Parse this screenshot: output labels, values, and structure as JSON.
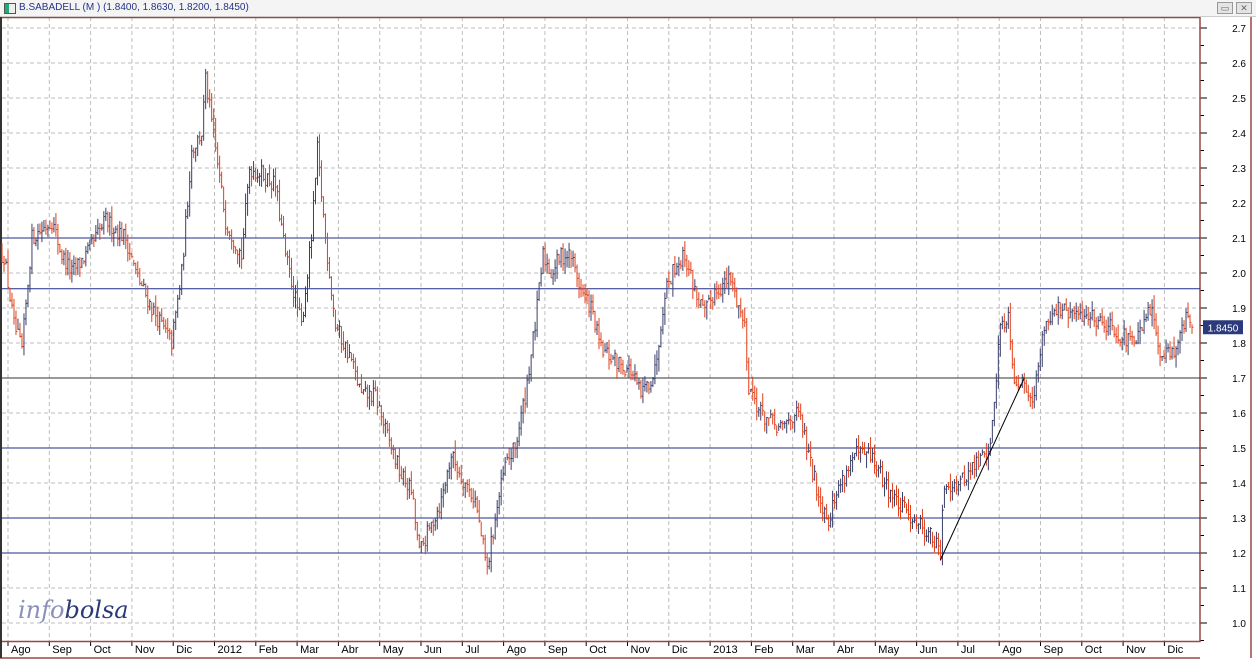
{
  "window": {
    "title": "B.SABADELL (M ) (1.8400, 1.8630, 1.8200, 1.8450)",
    "minimize": "▭",
    "close": "✕"
  },
  "logo": {
    "part1": "info",
    "part2": "bolsa"
  },
  "chart_data": {
    "type": "ohlc",
    "title": "B.SABADELL (M )",
    "last_ohlc": {
      "open": 1.84,
      "high": 1.863,
      "low": 1.82,
      "close": 1.845
    },
    "last_price_label": "1.8450",
    "ylim": [
      0.95,
      2.75
    ],
    "yticks": [
      "2.7",
      "2.6",
      "2.5",
      "2.4",
      "2.3",
      "2.2",
      "2.1",
      "2.0",
      "1.9",
      "1.8",
      "1.7",
      "1.6",
      "1.5",
      "1.4",
      "1.3",
      "1.2",
      "1.1",
      "1.0"
    ],
    "xticks": [
      "Ago",
      "Sep",
      "Oct",
      "Nov",
      "Dic",
      "2012",
      "Feb",
      "Mar",
      "Abr",
      "May",
      "Jun",
      "Jul",
      "Ago",
      "Sep",
      "Oct",
      "Nov",
      "Dic",
      "2013",
      "Feb",
      "Mar",
      "Abr",
      "May",
      "Jun",
      "Jul",
      "Ago",
      "Sep",
      "Oct",
      "Nov",
      "Dic"
    ],
    "x_unit": "trading-day index (approx.)",
    "n_days": 600,
    "horizontal_levels": [
      2.1,
      1.955,
      1.7,
      1.5,
      1.3,
      1.2
    ],
    "trendline": [
      [
        470,
        1.18
      ],
      [
        512,
        1.7
      ]
    ],
    "close_keypoints": [
      [
        1,
        2.05
      ],
      [
        6,
        1.85
      ],
      [
        10,
        1.78
      ],
      [
        15,
        2.1
      ],
      [
        25,
        2.15
      ],
      [
        30,
        2.05
      ],
      [
        35,
        2.0
      ],
      [
        42,
        2.05
      ],
      [
        52,
        2.15
      ],
      [
        62,
        2.1
      ],
      [
        67,
        2.0
      ],
      [
        75,
        1.9
      ],
      [
        85,
        1.8
      ],
      [
        90,
        2.0
      ],
      [
        95,
        2.35
      ],
      [
        100,
        2.4
      ],
      [
        102,
        2.55
      ],
      [
        107,
        2.35
      ],
      [
        112,
        2.15
      ],
      [
        120,
        2.05
      ],
      [
        124,
        2.3
      ],
      [
        131,
        2.28
      ],
      [
        137,
        2.25
      ],
      [
        142,
        2.05
      ],
      [
        150,
        1.85
      ],
      [
        155,
        2.1
      ],
      [
        158,
        2.35
      ],
      [
        162,
        2.1
      ],
      [
        167,
        1.85
      ],
      [
        175,
        1.75
      ],
      [
        180,
        1.65
      ],
      [
        187,
        1.65
      ],
      [
        192,
        1.55
      ],
      [
        200,
        1.42
      ],
      [
        205,
        1.38
      ],
      [
        209,
        1.2
      ],
      [
        215,
        1.28
      ],
      [
        220,
        1.35
      ],
      [
        225,
        1.48
      ],
      [
        230,
        1.42
      ],
      [
        237,
        1.35
      ],
      [
        243,
        1.15
      ],
      [
        247,
        1.3
      ],
      [
        252,
        1.45
      ],
      [
        257,
        1.5
      ],
      [
        262,
        1.65
      ],
      [
        267,
        1.85
      ],
      [
        271,
        2.05
      ],
      [
        275,
        2.0
      ],
      [
        280,
        2.05
      ],
      [
        285,
        2.05
      ],
      [
        290,
        1.95
      ],
      [
        295,
        1.9
      ],
      [
        300,
        1.78
      ],
      [
        307,
        1.75
      ],
      [
        315,
        1.72
      ],
      [
        320,
        1.65
      ],
      [
        327,
        1.72
      ],
      [
        332,
        1.95
      ],
      [
        337,
        2.02
      ],
      [
        342,
        2.05
      ],
      [
        347,
        1.95
      ],
      [
        352,
        1.88
      ],
      [
        357,
        1.95
      ],
      [
        365,
        1.98
      ],
      [
        372,
        1.85
      ],
      [
        374,
        1.68
      ],
      [
        380,
        1.6
      ],
      [
        390,
        1.55
      ],
      [
        397,
        1.6
      ],
      [
        400,
        1.58
      ],
      [
        405,
        1.45
      ],
      [
        410,
        1.35
      ],
      [
        414,
        1.3
      ],
      [
        420,
        1.4
      ],
      [
        427,
        1.48
      ],
      [
        435,
        1.48
      ],
      [
        442,
        1.4
      ],
      [
        450,
        1.33
      ],
      [
        457,
        1.3
      ],
      [
        465,
        1.25
      ],
      [
        470,
        1.2
      ],
      [
        472,
        1.4
      ],
      [
        480,
        1.4
      ],
      [
        487,
        1.45
      ],
      [
        495,
        1.5
      ],
      [
        500,
        1.85
      ],
      [
        504,
        1.88
      ],
      [
        507,
        1.7
      ],
      [
        512,
        1.68
      ],
      [
        517,
        1.65
      ],
      [
        522,
        1.85
      ],
      [
        527,
        1.9
      ],
      [
        535,
        1.88
      ],
      [
        545,
        1.88
      ],
      [
        555,
        1.85
      ],
      [
        565,
        1.8
      ],
      [
        570,
        1.82
      ],
      [
        575,
        1.9
      ],
      [
        580,
        1.78
      ],
      [
        587,
        1.78
      ],
      [
        594,
        1.88
      ],
      [
        596,
        1.845
      ]
    ],
    "colors": {
      "up": "#3a3f6a",
      "down": "#e0401a",
      "levels": "#1f2d8a",
      "trend": "#000000",
      "frame": "#9a4646",
      "grid": "#bdbdbd"
    }
  }
}
